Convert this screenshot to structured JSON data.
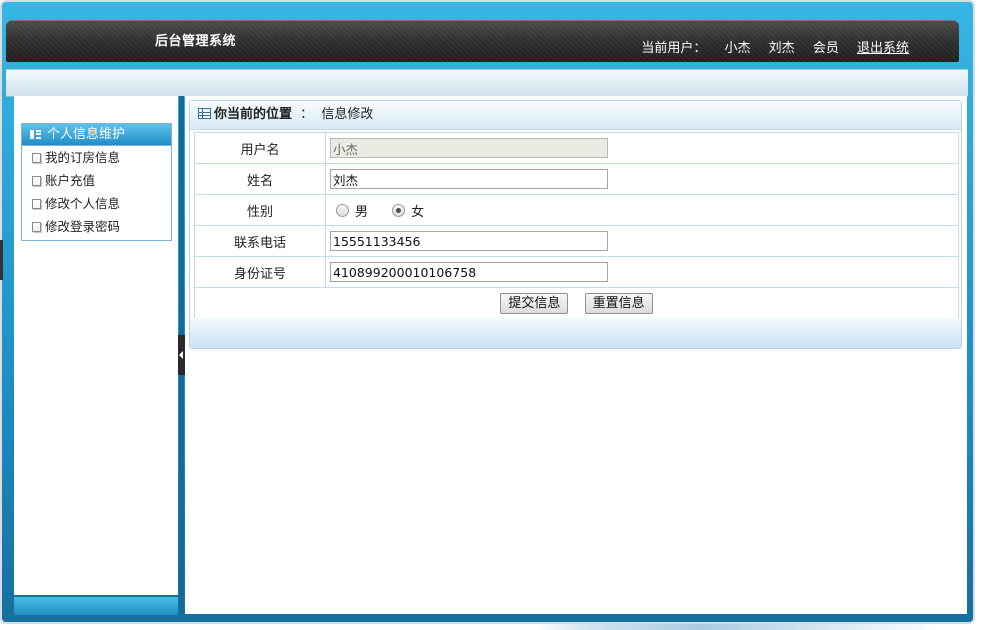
{
  "header": {
    "app_title": "后台管理系统",
    "current_user_label": "当前用户：",
    "username": "小杰",
    "real_name": "刘杰",
    "role": "会员",
    "logout_label": "退出系统"
  },
  "sidebar": {
    "section_title": "个人信息维护",
    "items": [
      {
        "label": "我的订房信息"
      },
      {
        "label": "账户充值"
      },
      {
        "label": "修改个人信息"
      },
      {
        "label": "修改登录密码"
      }
    ]
  },
  "breadcrumb": {
    "position_label": "你当前的位置",
    "separator": "：",
    "current_page": "信息修改"
  },
  "form": {
    "username": {
      "label": "用户名",
      "value": "小杰",
      "disabled": true
    },
    "name": {
      "label": "姓名",
      "value": "刘杰"
    },
    "gender": {
      "label": "性别",
      "options": [
        {
          "label": "男",
          "selected": false
        },
        {
          "label": "女",
          "selected": true
        }
      ]
    },
    "phone": {
      "label": "联系电话",
      "value": "15551133456"
    },
    "id_number": {
      "label": "身份证号",
      "value": "410899200010106758"
    },
    "submit_label": "提交信息",
    "reset_label": "重置信息"
  },
  "colors": {
    "accent_blue": "#1e8fc5",
    "header_dark": "#2c2c2c"
  }
}
